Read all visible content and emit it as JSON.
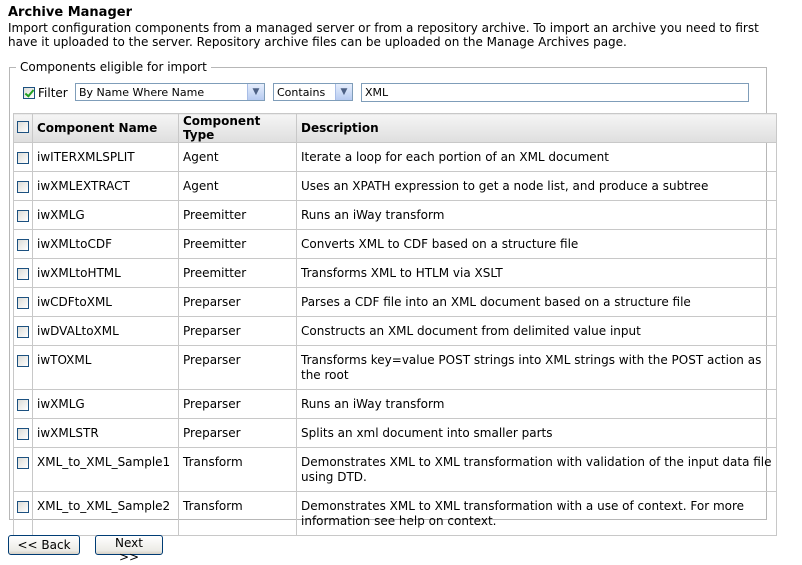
{
  "page": {
    "title": "Archive Manager",
    "intro": "Import configuration components from a managed server or from a repository archive. To import an archive you need to first have it uploaded to the server. Repository archive files can be uploaded on the Manage Archives page."
  },
  "section": {
    "legend": "Components eligible for import"
  },
  "filter": {
    "label": "Filter",
    "checked": true,
    "field_select": "By Name Where Name",
    "operator_select": "Contains",
    "value": "XML"
  },
  "table": {
    "headers": {
      "name": "Component Name",
      "type": "Component Type",
      "description": "Description"
    },
    "rows": [
      {
        "name": "iwITERXMLSPLIT",
        "type": "Agent",
        "description": "Iterate a loop for each portion of an XML document"
      },
      {
        "name": "iwXMLEXTRACT",
        "type": "Agent",
        "description": "Uses an XPATH expression to get a node list, and produce a subtree"
      },
      {
        "name": "iwXMLG",
        "type": "Preemitter",
        "description": "Runs an iWay transform"
      },
      {
        "name": "iwXMLtoCDF",
        "type": "Preemitter",
        "description": "Converts XML to CDF based on a structure file"
      },
      {
        "name": "iwXMLtoHTML",
        "type": "Preemitter",
        "description": "Transforms XML to HTLM via XSLT"
      },
      {
        "name": "iwCDFtoXML",
        "type": "Preparser",
        "description": "Parses a CDF file into an XML document based on a structure file"
      },
      {
        "name": "iwDVALtoXML",
        "type": "Preparser",
        "description": "Constructs an XML document from delimited value input"
      },
      {
        "name": "iwTOXML",
        "type": "Preparser",
        "description": "Transforms key=value POST strings into XML strings with the POST action as the root"
      },
      {
        "name": "iwXMLG",
        "type": "Preparser",
        "description": "Runs an iWay transform"
      },
      {
        "name": "iwXMLSTR",
        "type": "Preparser",
        "description": "Splits an xml document into smaller parts"
      },
      {
        "name": "XML_to_XML_Sample1",
        "type": "Transform",
        "description": "Demonstrates XML to XML transformation with validation of the input data file using DTD."
      },
      {
        "name": "XML_to_XML_Sample2",
        "type": "Transform",
        "description": "Demonstrates XML to XML transformation with a use of context. For more information see help on context."
      }
    ]
  },
  "buttons": {
    "back": "<< Back",
    "next": "Next >>"
  }
}
